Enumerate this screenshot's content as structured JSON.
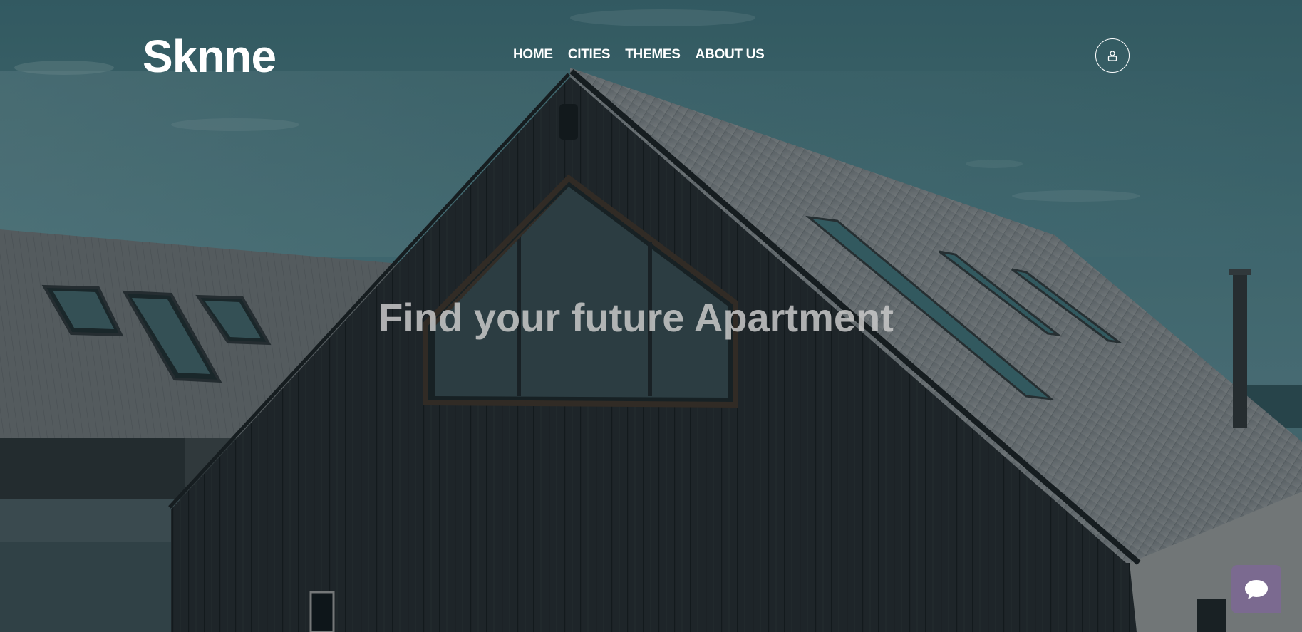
{
  "header": {
    "logo": "Sknne",
    "nav": [
      "HOME",
      "CITIES",
      "THEMES",
      "ABOUT US"
    ],
    "user_icon": "user-icon"
  },
  "hero": {
    "headline": "Find your future Apartment",
    "background": "dark-wooden-house-photo"
  },
  "chat": {
    "icon": "chat-bubble-icon",
    "color": "#7b6a90"
  },
  "colors": {
    "sky": "#3f6b73",
    "text": "#ffffff",
    "headline": "#c9c9c9"
  }
}
